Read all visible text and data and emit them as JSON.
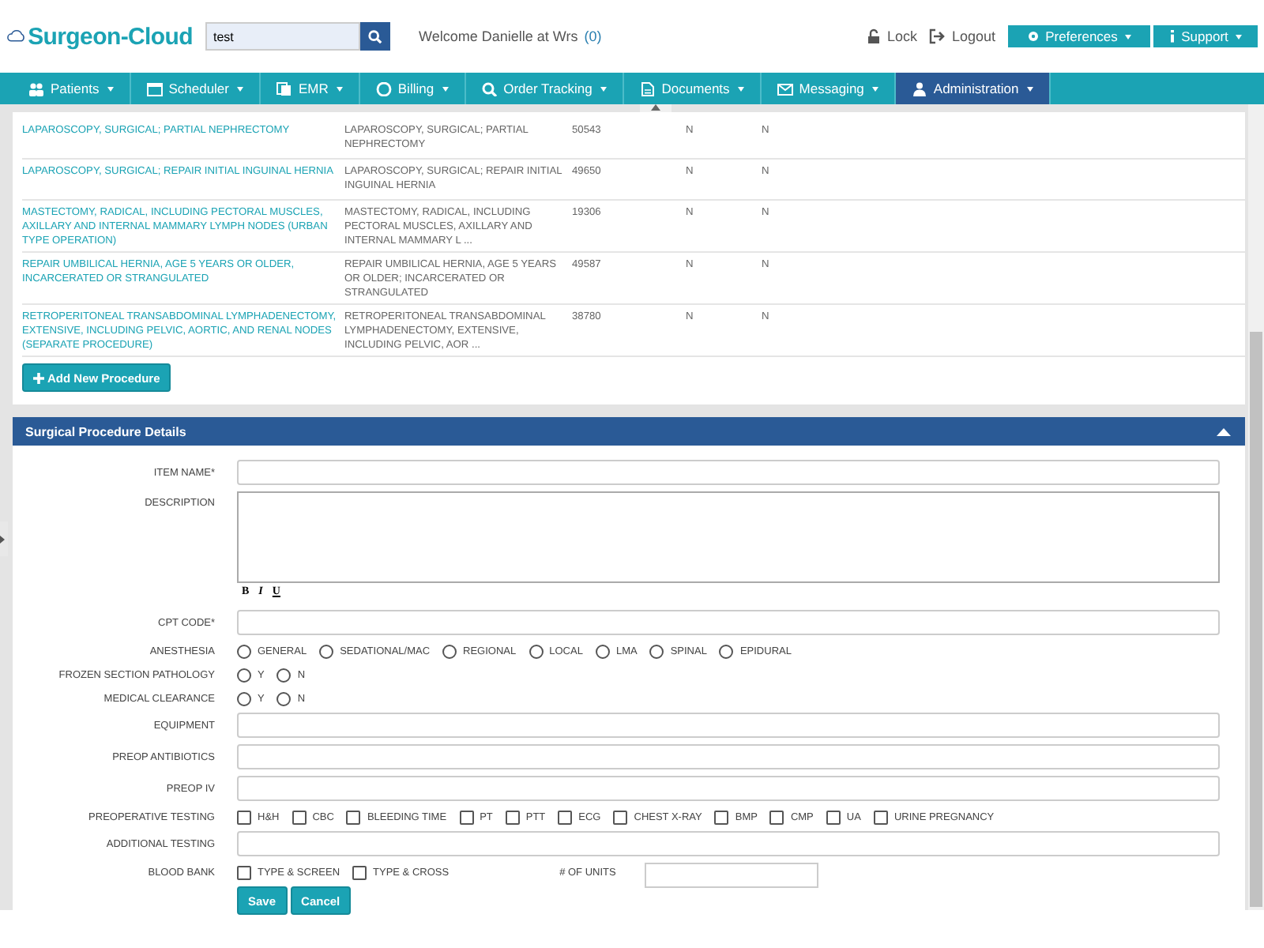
{
  "header": {
    "logo": "Surgeon-Cloud",
    "search": {
      "value": "test"
    },
    "welcome": "Welcome Danielle at Wrs",
    "welcome_count": "(0)",
    "lock": "Lock",
    "logout": "Logout",
    "preferences": "Preferences",
    "support": "Support"
  },
  "nav": [
    {
      "label": "Patients",
      "selected": false
    },
    {
      "label": "Scheduler",
      "selected": false
    },
    {
      "label": "EMR",
      "selected": false
    },
    {
      "label": "Billing",
      "selected": false
    },
    {
      "label": "Order Tracking",
      "selected": false
    },
    {
      "label": "Documents",
      "selected": false
    },
    {
      "label": "Messaging",
      "selected": false
    },
    {
      "label": "Administration",
      "selected": true
    }
  ],
  "procedures": [
    {
      "name": "LAPAROSCOPY, SURGICAL; PARTIAL NEPHRECTOMY",
      "description": "LAPAROSCOPY, SURGICAL; PARTIAL NEPHRECTOMY",
      "code": "50543",
      "column_4": "N",
      "column_5": "N"
    },
    {
      "name": "LAPAROSCOPY, SURGICAL; REPAIR INITIAL INGUINAL HERNIA",
      "description": "LAPAROSCOPY, SURGICAL; REPAIR INITIAL INGUINAL HERNIA",
      "code": "49650",
      "column_4": "N",
      "column_5": "N"
    },
    {
      "name": "MASTECTOMY, RADICAL, INCLUDING PECTORAL MUSCLES, AXILLARY AND INTERNAL MAMMARY LYMPH NODES (URBAN TYPE OPERATION)",
      "description": "MASTECTOMY, RADICAL, INCLUDING PECTORAL MUSCLES, AXILLARY AND INTERNAL MAMMARY L ...",
      "code": "19306",
      "column_4": "N",
      "column_5": "N"
    },
    {
      "name": "REPAIR UMBILICAL HERNIA, AGE 5 YEARS OR OLDER, INCARCERATED OR STRANGULATED",
      "description": "REPAIR UMBILICAL HERNIA, AGE 5 YEARS OR OLDER; INCARCERATED OR STRANGULATED",
      "code": "49587",
      "column_4": "N",
      "column_5": "N"
    },
    {
      "name": "RETROPERITONEAL TRANSABDOMINAL LYMPHADENECTOMY, EXTENSIVE, INCLUDING PELVIC, AORTIC, AND RENAL NODES (SEPARATE PROCEDURE)",
      "description": "RETROPERITONEAL TRANSABDOMINAL LYMPHADENECTOMY, EXTENSIVE, INCLUDING PELVIC, AOR ...",
      "code": "38780",
      "column_4": "N",
      "column_5": "N"
    }
  ],
  "add_button": "Add New Procedure",
  "form": {
    "title": "Surgical Procedure Details",
    "fields": [
      {
        "kind": "text",
        "label": "ITEM NAME*"
      },
      {
        "kind": "textarea",
        "label": "DESCRIPTION",
        "toolbar": [
          "B",
          "I",
          "U"
        ]
      },
      {
        "kind": "text",
        "label": "CPT CODE*"
      },
      {
        "kind": "radio",
        "label": "ANESTHESIA",
        "options": [
          {
            "label": "GENERAL",
            "selected": false
          },
          {
            "label": "SEDATIONAL/MAC",
            "selected": false
          },
          {
            "label": "REGIONAL",
            "selected": false
          },
          {
            "label": "LOCAL",
            "selected": false
          },
          {
            "label": "LMA",
            "selected": false
          },
          {
            "label": "SPINAL",
            "selected": false
          },
          {
            "label": "EPIDURAL",
            "selected": false
          }
        ]
      },
      {
        "kind": "radio",
        "label": "FROZEN SECTION PATHOLOGY",
        "options": [
          {
            "label": "Y",
            "selected": false
          },
          {
            "label": "N",
            "selected": false
          }
        ]
      },
      {
        "kind": "radio",
        "label": "MEDICAL CLEARANCE",
        "options": [
          {
            "label": "Y",
            "selected": false
          },
          {
            "label": "N",
            "selected": false
          }
        ]
      },
      {
        "kind": "text",
        "label": "EQUIPMENT"
      },
      {
        "kind": "text",
        "label": "PREOP ANTIBIOTICS"
      },
      {
        "kind": "text",
        "label": "PREOP IV"
      },
      {
        "kind": "checkbox",
        "label": "PREOPERATIVE TESTING",
        "options": [
          {
            "label": "H&H",
            "checked": false
          },
          {
            "label": "CBC",
            "checked": false
          },
          {
            "label": "BLEEDING TIME",
            "checked": false
          },
          {
            "label": "PT",
            "checked": false
          },
          {
            "label": "PTT",
            "checked": false
          },
          {
            "label": "ECG",
            "checked": false
          },
          {
            "label": "CHEST X-RAY",
            "checked": false
          },
          {
            "label": "BMP",
            "checked": false
          },
          {
            "label": "CMP",
            "checked": false
          },
          {
            "label": "UA",
            "checked": false
          },
          {
            "label": "URINE PREGNANCY",
            "checked": false
          }
        ]
      },
      {
        "kind": "text",
        "label": "ADDITIONAL TESTING"
      },
      {
        "kind": "checkbox",
        "label": "BLOOD BANK",
        "options": [
          {
            "label": "TYPE & SCREEN",
            "checked": false
          },
          {
            "label": "TYPE & CROSS",
            "checked": false
          }
        ],
        "units_label": "# OF UNITS"
      }
    ],
    "buttons": [
      "Save",
      "Cancel"
    ]
  }
}
